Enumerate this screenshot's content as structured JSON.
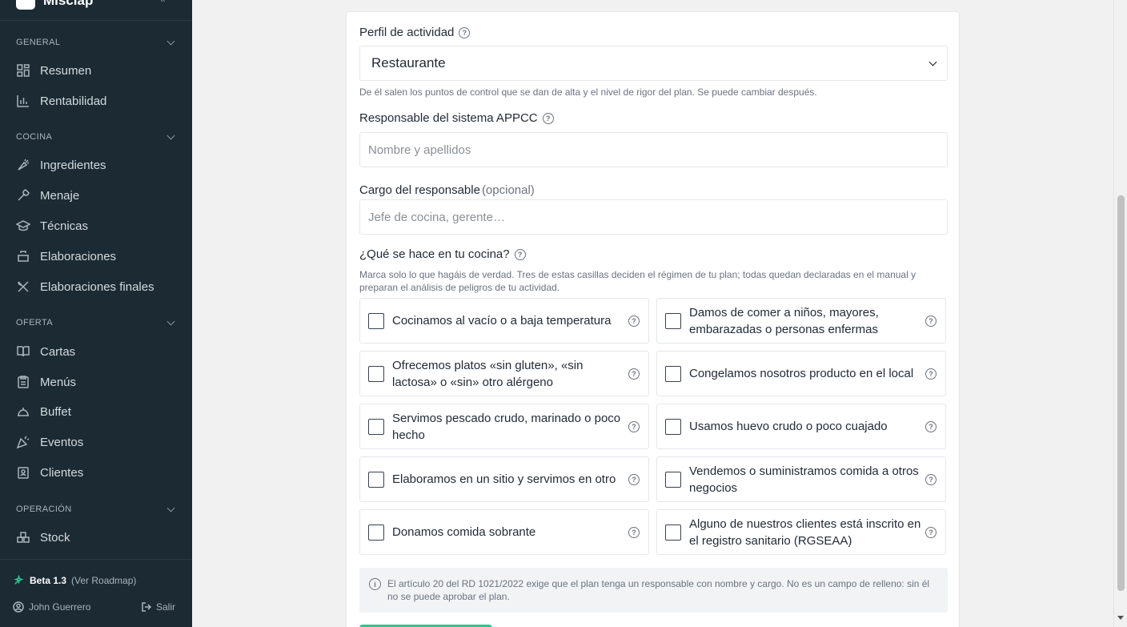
{
  "sidebar": {
    "brand": "Misclap",
    "sections": [
      {
        "title": "GENERAL",
        "items": [
          {
            "label": "Resumen",
            "icon": "dashboard-icon"
          },
          {
            "label": "Rentabilidad",
            "icon": "bar-chart-icon"
          }
        ]
      },
      {
        "title": "COCINA",
        "items": [
          {
            "label": "Ingredientes",
            "icon": "carrot-icon"
          },
          {
            "label": "Menaje",
            "icon": "utensils-icon"
          },
          {
            "label": "Técnicas",
            "icon": "graduation-cap-icon"
          },
          {
            "label": "Elaboraciones",
            "icon": "cooking-pot-icon"
          },
          {
            "label": "Elaboraciones finales",
            "icon": "crossed-utensils-icon"
          }
        ]
      },
      {
        "title": "OFERTA",
        "items": [
          {
            "label": "Cartas",
            "icon": "book-open-icon"
          },
          {
            "label": "Menús",
            "icon": "clipboard-icon"
          },
          {
            "label": "Buffet",
            "icon": "cloche-icon"
          },
          {
            "label": "Eventos",
            "icon": "party-icon"
          },
          {
            "label": "Clientes",
            "icon": "contact-icon"
          }
        ]
      },
      {
        "title": "OPERACIÓN",
        "items": [
          {
            "label": "Stock",
            "icon": "boxes-icon"
          }
        ]
      }
    ],
    "footer": {
      "version": "Beta 1.3",
      "roadmap": "(Ver Roadmap)",
      "user": "John Guerrero",
      "logout": "Salir"
    }
  },
  "form": {
    "perfil": {
      "label": "Perfil de actividad",
      "value": "Restaurante",
      "hint": "De él salen los puntos de control que se dan de alta y el nivel de rigor del plan. Se puede cambiar después."
    },
    "responsable": {
      "label": "Responsable del sistema APPCC",
      "placeholder": "Nombre y apellidos"
    },
    "cargo": {
      "label": "Cargo del responsable",
      "optional": "(opcional)",
      "placeholder": "Jefe de cocina, gerente…"
    },
    "cocina": {
      "label": "¿Qué se hace en tu cocina?",
      "hint": "Marca solo lo que hagáis de verdad. Tres de estas casillas deciden el régimen de tu plan; todas quedan declaradas en el manual y preparan el análisis de peligros de tu actividad.",
      "options": [
        {
          "label": "Cocinamos al vacío o a baja temperatura",
          "checked": false
        },
        {
          "label": "Damos de comer a niños, mayores, embarazadas o personas enfermas",
          "checked": false
        },
        {
          "label": "Ofrecemos platos «sin gluten», «sin lactosa» o «sin» otro alérgeno",
          "checked": false
        },
        {
          "label": "Congelamos nosotros producto en el local",
          "checked": false
        },
        {
          "label": "Servimos pescado crudo, marinado o poco hecho",
          "checked": false
        },
        {
          "label": "Usamos huevo crudo o poco cuajado",
          "checked": false
        },
        {
          "label": "Elaboramos en un sitio y servimos en otro",
          "checked": false
        },
        {
          "label": "Vendemos o suministramos comida a otros negocios",
          "checked": false
        },
        {
          "label": "Donamos comida sobrante",
          "checked": false
        },
        {
          "label": "Alguno de nuestros clientes está inscrito en el registro sanitario (RGSEAA)",
          "checked": false
        }
      ]
    },
    "notice": "El artículo 20 del RD 1021/2022 exige que el plan tenga un responsable con nombre y cargo. No es un campo de relleno: sin él no se puede aprobar el plan."
  }
}
